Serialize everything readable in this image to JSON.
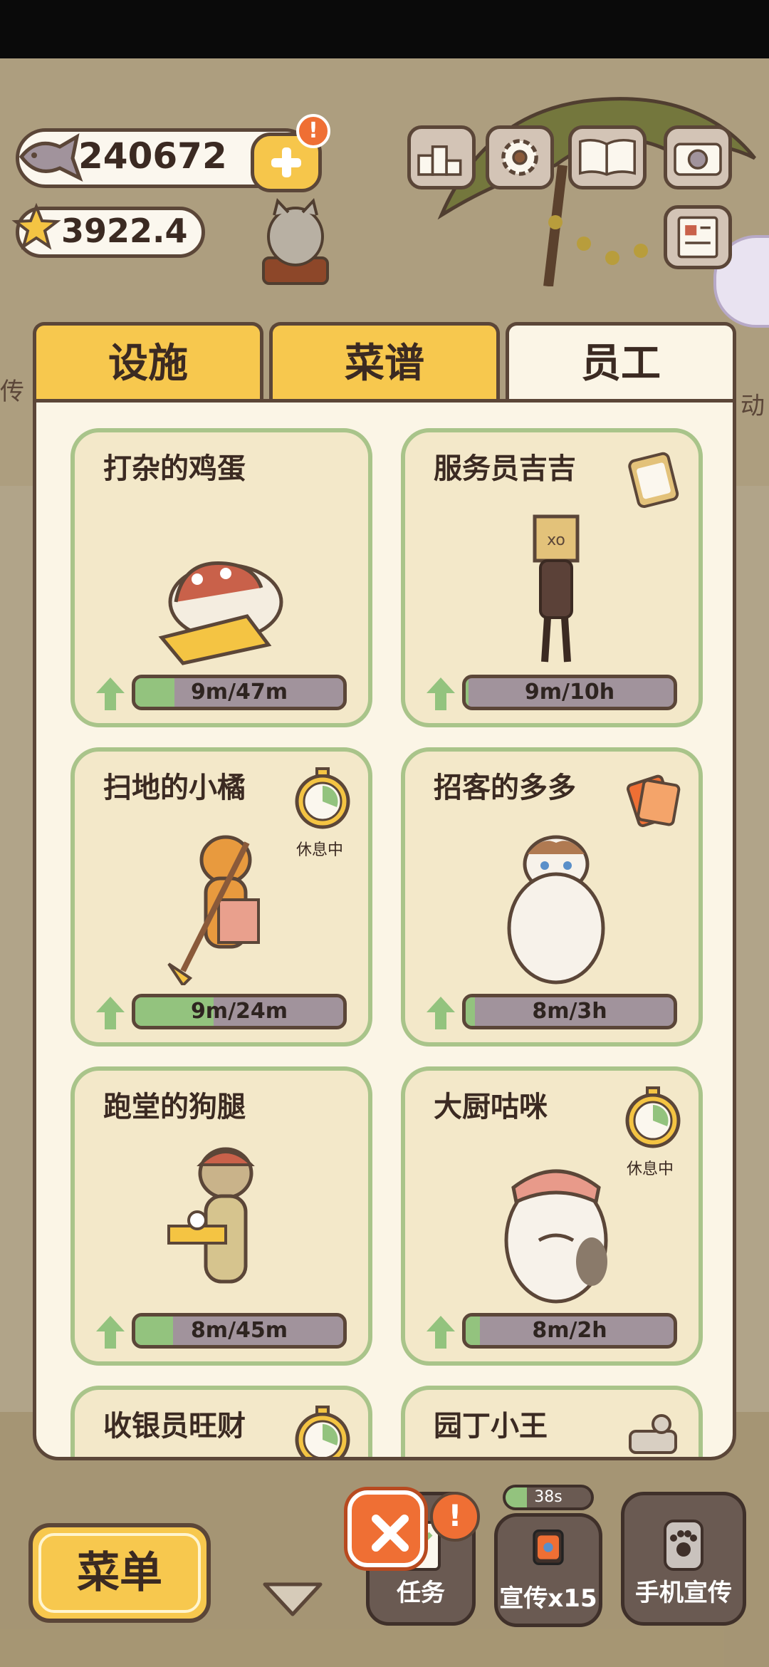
{
  "currency": {
    "coins": "240672",
    "stars": "3922.4",
    "alert": "!"
  },
  "tabs": [
    {
      "label": "设施",
      "active": false
    },
    {
      "label": "菜谱",
      "active": false
    },
    {
      "label": "员工",
      "active": true
    }
  ],
  "staff": [
    {
      "name": "打杂的鸡蛋",
      "progress": "9m/47m",
      "fill": 0.19,
      "resting": false,
      "badge": ""
    },
    {
      "name": "服务员吉吉",
      "progress": "9m/10h",
      "fill": 0.015,
      "resting": false,
      "badge": "clipboard-icon"
    },
    {
      "name": "扫地的小橘",
      "progress": "9m/24m",
      "fill": 0.375,
      "resting": true,
      "badge": "stopwatch-icon"
    },
    {
      "name": "招客的多多",
      "progress": "8m/3h",
      "fill": 0.044,
      "resting": false,
      "badge": "flyer-icon"
    },
    {
      "name": "跑堂的狗腿",
      "progress": "8m/45m",
      "fill": 0.18,
      "resting": false,
      "badge": ""
    },
    {
      "name": "大厨咕咪",
      "progress": "8m/2h",
      "fill": 0.067,
      "resting": true,
      "badge": "stopwatch-icon"
    },
    {
      "name": "收银员旺财",
      "progress": "",
      "fill": 0,
      "resting": true,
      "badge": "stopwatch-icon"
    },
    {
      "name": "园丁小王",
      "progress": "",
      "fill": 0,
      "resting": false,
      "badge": "tools-icon"
    }
  ],
  "rest_label": "休息中",
  "bottom_nav": {
    "menu": "菜单",
    "tasks": "任务",
    "promo": "宣传x15",
    "phone_promo": "手机宣传",
    "timer": "38s",
    "timer_fill": 0.25
  },
  "side_text": {
    "left": "传",
    "right": "动"
  },
  "colors": {
    "accent_yellow": "#f7c84e",
    "card_border": "#a9c48a",
    "progress_fill": "#93c37e",
    "close_orange": "#ef6f34"
  }
}
